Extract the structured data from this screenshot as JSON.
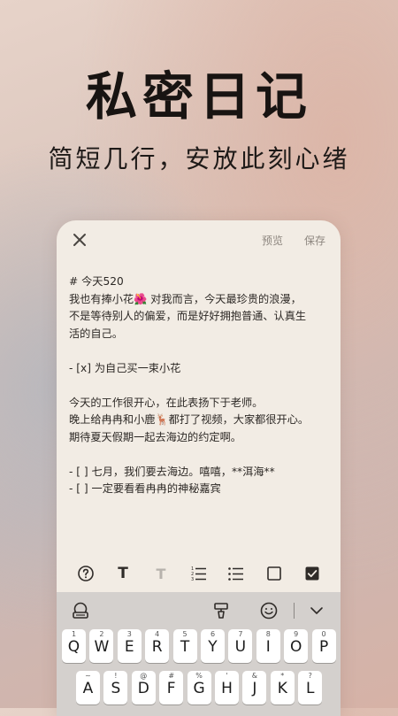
{
  "hero": {
    "title": "私密日记",
    "subtitle": "简短几行，安放此刻心绪"
  },
  "editor_header": {
    "close_icon": "close-icon",
    "preview_label": "预览",
    "save_label": "保存"
  },
  "editor": {
    "lines": [
      "# 今天520",
      "我也有捧小花🌺 对我而言，今天最珍贵的浪漫，",
      "不是等待别人的偏爱，而是好好拥抱普通、认真生",
      "活的自己。",
      "",
      "- [x] 为自己买一束小花",
      "",
      "今天的工作很开心，在此表扬下于老师。",
      "晚上给冉冉和小鹿🦌都打了视频，大家都很开心。",
      "期待夏天假期一起去海边的约定啊。",
      "",
      "- [ ] 七月，我们要去海边。嘻嘻，**洱海**",
      "- [ ] 一定要看看冉冉的神秘嘉宾"
    ]
  },
  "format_toolbar": {
    "help_icon": "help-circle-icon",
    "bold_label": "T",
    "light_label": "T",
    "ordered_list_icon": "ordered-list-icon",
    "bullet_list_icon": "bullet-list-icon",
    "checkbox_icon": "checkbox-empty-icon",
    "checked_icon": "checkbox-checked-icon"
  },
  "keyboard": {
    "top_icons": [
      "keyboard-settings-icon",
      "paint-icon",
      "emoji-icon",
      "chevron-down-icon"
    ],
    "row1": [
      {
        "key": "Q",
        "hint": "1"
      },
      {
        "key": "W",
        "hint": "2"
      },
      {
        "key": "E",
        "hint": "3"
      },
      {
        "key": "R",
        "hint": "4"
      },
      {
        "key": "T",
        "hint": "5"
      },
      {
        "key": "Y",
        "hint": "6"
      },
      {
        "key": "U",
        "hint": "7"
      },
      {
        "key": "I",
        "hint": "8"
      },
      {
        "key": "O",
        "hint": "9"
      },
      {
        "key": "P",
        "hint": "0"
      }
    ],
    "row2": [
      {
        "key": "A",
        "hint": "~"
      },
      {
        "key": "S",
        "hint": "!"
      },
      {
        "key": "D",
        "hint": "@"
      },
      {
        "key": "F",
        "hint": "#"
      },
      {
        "key": "G",
        "hint": "%"
      },
      {
        "key": "H",
        "hint": "'"
      },
      {
        "key": "J",
        "hint": "&"
      },
      {
        "key": "K",
        "hint": "*"
      },
      {
        "key": "L",
        "hint": "?"
      }
    ]
  }
}
